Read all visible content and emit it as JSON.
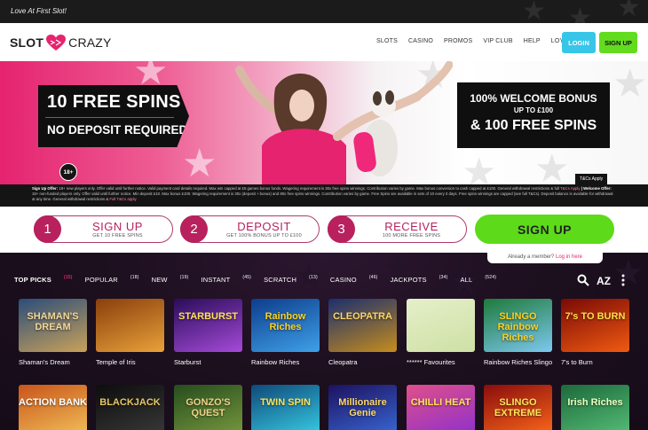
{
  "topbar": {
    "tagline": "Love At First Slot!"
  },
  "header": {
    "logo_left": "SLOT",
    "logo_right": "CRAZY",
    "nav": [
      "SLOTS",
      "CASINO",
      "PROMOS",
      "VIP CLUB",
      "HELP",
      "LOYALTY"
    ],
    "login": "LOGIN",
    "signup": "SIGN UP"
  },
  "hero": {
    "left_line1": "10 FREE SPINS",
    "left_line2": "NO DEPOSIT REQUIRED",
    "right_line1": "100% WELCOME BONUS",
    "right_line2": "UP TO £100",
    "right_line3": "& 100 FREE SPINS",
    "age_badge": "18+",
    "tcs": "T&Cs Apply",
    "terms_label1": "Sign Up Offer:",
    "terms_text1": " 18+ new players only. Offer valid until further notice. Valid payment card details required. Max win capped at £5 games bonus funds. Wagering requirement is 30x free spins winnings. Contribution varies by game. Max bonus conversion to cash capped at £100. General withdrawal restrictions & full ",
    "terms_link1": "T&Cs Apply",
    "terms_label2": " | Welcome Offer:",
    "terms_text2": " 18+ non-funded players only. Offer valid until further notice. Min deposit £10. Max bonus £100. Wagering requirement is 30x (deposit + bonus) and 80x free spins winnings. Contribution varies by game. Free Spins are available in sets of 10 every 3 days. Free spins winnings are capped (see full T&Cs). Deposit balance is available for withdrawal at any time. General withdrawal restrictions & ",
    "terms_link2": "Full T&Cs apply"
  },
  "steps": [
    {
      "num": "1",
      "title": "SIGN UP",
      "sub": "GET 10 FREE SPINS"
    },
    {
      "num": "2",
      "title": "DEPOSIT",
      "sub": "GET 100% BONUS UP TO £100"
    },
    {
      "num": "3",
      "title": "RECEIVE",
      "sub": "100 MORE FREE SPINS"
    }
  ],
  "cta": {
    "signup": "SIGN UP",
    "member_q": "Already a member?",
    "member_link": "Log in here"
  },
  "filters": [
    {
      "label": "TOP PICKS",
      "count": "(15)"
    },
    {
      "label": "POPULAR",
      "count": "(18)"
    },
    {
      "label": "NEW",
      "count": "(19)"
    },
    {
      "label": "INSTANT",
      "count": "(45)"
    },
    {
      "label": "SCRATCH",
      "count": "(13)"
    },
    {
      "label": "CASINO",
      "count": "(46)"
    },
    {
      "label": "JACKPOTS",
      "count": "(34)"
    },
    {
      "label": "ALL",
      "count": "(524)"
    }
  ],
  "sort_icon_label": "AZ",
  "games_row1": [
    {
      "name": "Shaman's Dream",
      "art": "SHAMAN'S DREAM",
      "c1": "#2b4d7a",
      "c2": "#c9a15a",
      "tc": "#f2d89a"
    },
    {
      "name": "Temple of Iris",
      "art": "",
      "c1": "#8a3f0c",
      "c2": "#e8a13a",
      "tc": "#ffd27a"
    },
    {
      "name": "Starburst",
      "art": "STARBURST",
      "c1": "#2a0d5a",
      "c2": "#a54ad8",
      "tc": "#ffe35a"
    },
    {
      "name": "Rainbow Riches",
      "art": "Rainbow Riches",
      "c1": "#0d3d8c",
      "c2": "#3fa0e8",
      "tc": "#ffd21f"
    },
    {
      "name": "Cleopatra",
      "art": "CLEOPATRA",
      "c1": "#1b2f6e",
      "c2": "#c58c1e",
      "tc": "#ffd76a"
    },
    {
      "name": "****** Favourites",
      "art": "",
      "c1": "#e4efc9",
      "c2": "#cfe0a5",
      "tc": "#fff"
    },
    {
      "name": "Rainbow Riches Slingo",
      "art": "SLINGO Rainbow Riches",
      "c1": "#1e7a3a",
      "c2": "#7dc8f0",
      "tc": "#ffd21f"
    },
    {
      "name": "7's to Burn",
      "art": "7's TO BURN",
      "c1": "#7a0a05",
      "c2": "#f05a12",
      "tc": "#ffe04a"
    }
  ],
  "games_row2": [
    {
      "art": "ACTION BANK",
      "c1": "#c9551a",
      "c2": "#f2c25a",
      "tc": "#ffffff"
    },
    {
      "art": "BLACKJACK",
      "c1": "#0d0d0d",
      "c2": "#3a3a3a",
      "tc": "#e8c766"
    },
    {
      "art": "GONZO'S QUEST",
      "c1": "#264d1e",
      "c2": "#7a9a3e",
      "tc": "#f0d28a"
    },
    {
      "art": "TWIN SPIN",
      "c1": "#0e4a7a",
      "c2": "#3ad0e8",
      "tc": "#ffe35a"
    },
    {
      "art": "Millionaire Genie",
      "c1": "#1c1260",
      "c2": "#3a6ad8",
      "tc": "#ffd76a"
    },
    {
      "art": "CHILLI HEAT",
      "c1": "#e04f8a",
      "c2": "#8b2fd0",
      "tc": "#ffe35a"
    },
    {
      "art": "SLINGO EXTREME",
      "c1": "#8a0d0d",
      "c2": "#ff6a1a",
      "tc": "#ffe35a"
    },
    {
      "art": "Irish Riches",
      "c1": "#1d6a3a",
      "c2": "#57c07a",
      "tc": "#eaffc2"
    }
  ],
  "colors": {
    "brand_pink": "#e5236f",
    "accent_green": "#5ddb1a",
    "login_blue": "#37c6e8"
  }
}
